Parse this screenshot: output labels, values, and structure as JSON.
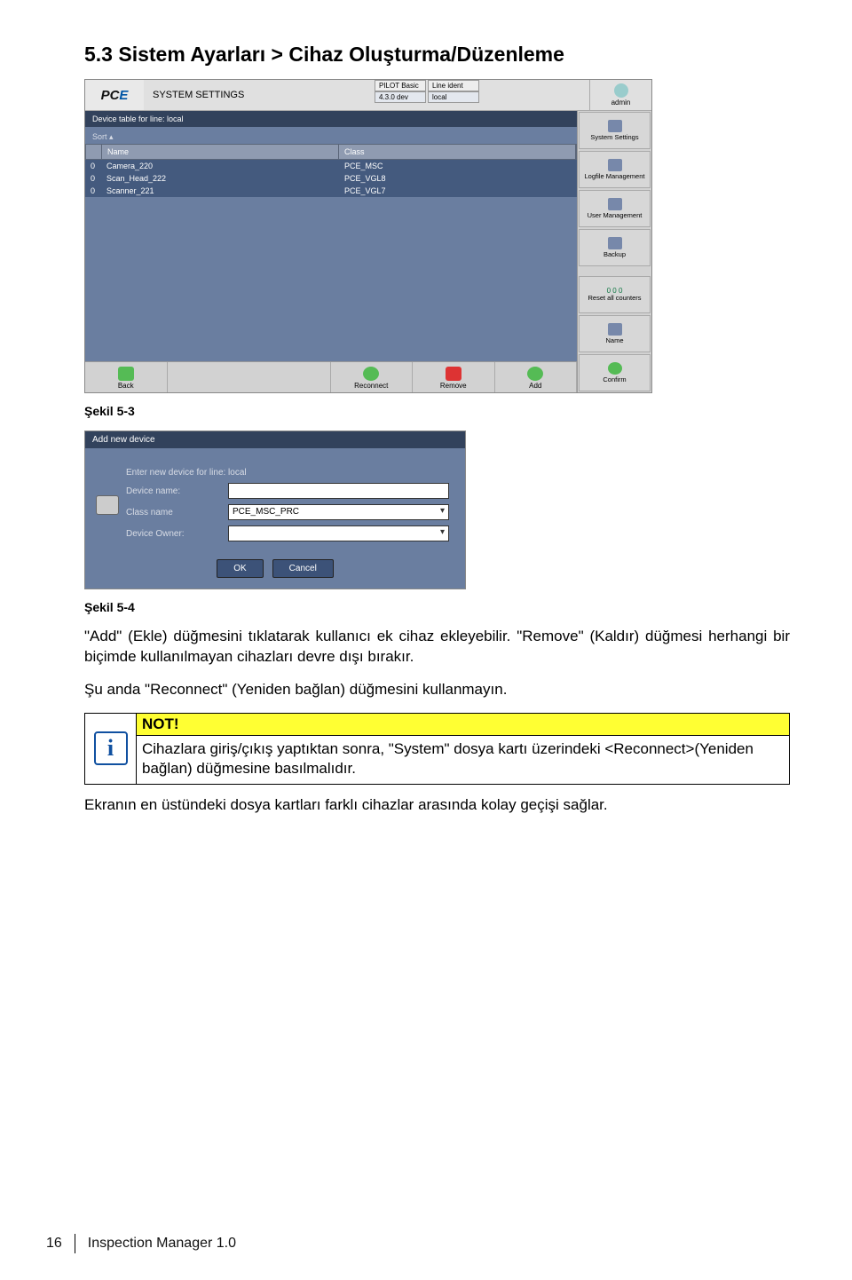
{
  "section_title": "5.3   Sistem Ayarları > Cihaz Oluşturma/Düzenleme",
  "ss1": {
    "logo1": "PC",
    "logo2": "E",
    "window_title": "SYSTEM SETTINGS",
    "tab_pilot": "PILOT Basic",
    "tab_line": "Line ident",
    "tab_ver": "4.3.0 dev",
    "tab_local": "local",
    "user_label": "admin",
    "panel_header": "Device table for line: local",
    "sort_label": "Sort ▴",
    "col_name": "Name",
    "col_class": "Class",
    "rows": [
      {
        "n": "0",
        "name": "Camera_220",
        "cls": "PCE_MSC"
      },
      {
        "n": "0",
        "name": "Scan_Head_222",
        "cls": "PCE_VGL8"
      },
      {
        "n": "0",
        "name": "Scanner_221",
        "cls": "PCE_VGL7"
      }
    ],
    "btn_back": "Back",
    "btn_reconnect": "Reconnect",
    "btn_remove": "Remove",
    "btn_add": "Add",
    "side_settings": "System Settings",
    "side_log": "Logfile Management",
    "side_user": "User Management",
    "side_backup": "Backup",
    "side_counter": "0  0\n0",
    "side_reset": "Reset all counters",
    "side_name": "Name",
    "side_confirm": "Confirm"
  },
  "caption1": "Şekil 5-3",
  "ss2": {
    "title": "Add new device",
    "prompt": "Enter new device for line: local",
    "lbl_name": "Device name:",
    "lbl_class": "Class name",
    "val_class": "PCE_MSC_PRC",
    "lbl_owner": "Device Owner:",
    "btn_ok": "OK",
    "btn_cancel": "Cancel"
  },
  "caption2": "Şekil 5-4",
  "para1": "\"Add\" (Ekle) düğmesini tıklatarak kullanıcı ek cihaz ekleyebilir. \"Remove\" (Kaldır) düğmesi herhangi bir biçimde kullanılmayan cihazları devre dışı bırakır.",
  "para2": "Şu anda \"Reconnect\" (Yeniden bağlan) düğmesini kullanmayın.",
  "note_head": "NOT!",
  "note_text": "Cihazlara giriş/çıkış yaptıktan sonra, \"System\" dosya kartı üzerindeki <Reconnect>(Yeniden bağlan) düğmesine basılmalıdır.",
  "para3": "Ekranın en üstündeki dosya kartları farklı cihazlar arasında kolay geçişi sağlar.",
  "page_number": "16",
  "doc_title": "Inspection Manager 1.0"
}
